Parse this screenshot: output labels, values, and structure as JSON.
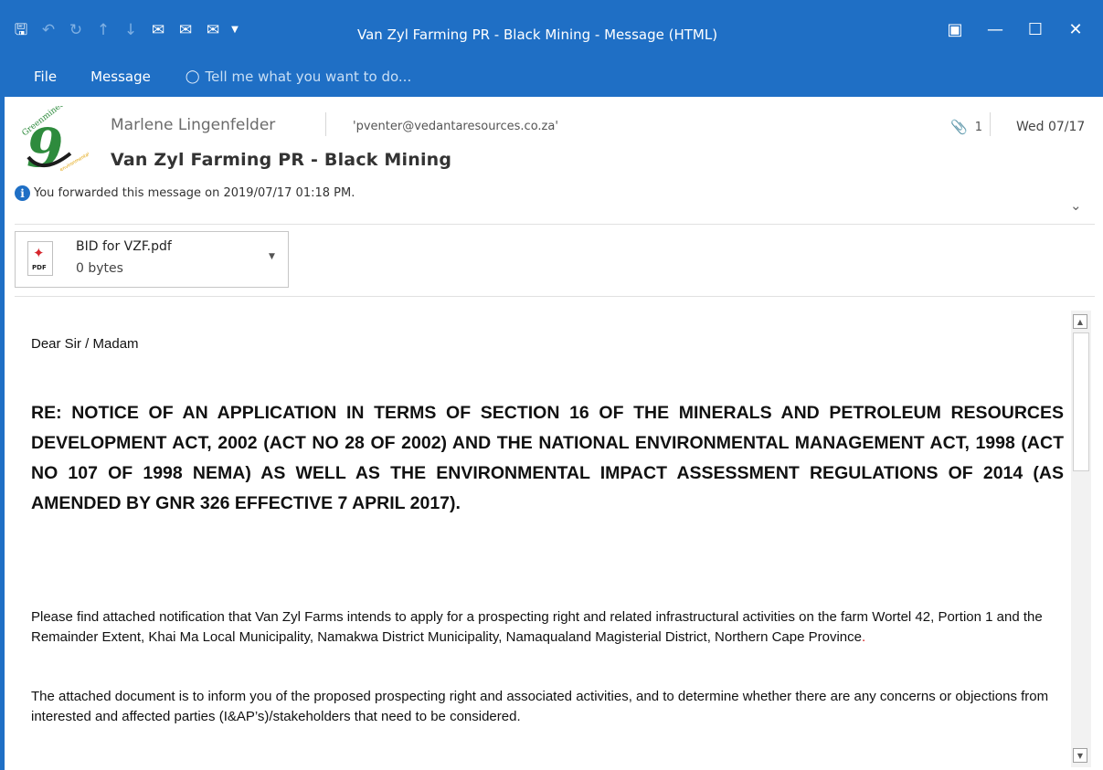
{
  "window": {
    "title": "Van Zyl Farming PR - Black Mining - Message (HTML)"
  },
  "qat": {
    "save_icon": "save-icon",
    "undo_icon": "undo-icon",
    "redo_icon": "redo-icon",
    "up_icon": "arrow-up-icon",
    "down_icon": "arrow-down-icon",
    "reply_icon": "reply-icon",
    "reply_all_icon": "reply-all-icon",
    "forward_icon": "forward-icon"
  },
  "menu": {
    "file": "File",
    "message": "Message",
    "tell_me": "Tell me what you want to do..."
  },
  "header": {
    "sender": "Marlene Lingenfelder",
    "recipient": "'pventer@vedantaresources.co.za'",
    "attachment_count": "1",
    "date": "Wed 07/17",
    "subject": "Van Zyl Farming PR - Black Mining",
    "info": "You forwarded this message on 2019/07/17 01:18 PM.",
    "logo_text": "Greenmined"
  },
  "attachment": {
    "name": "BID for VZF.pdf",
    "size": "0 bytes",
    "type_label": "PDF"
  },
  "body": {
    "greeting": "Dear Sir / Madam",
    "re_heading": "RE: NOTICE OF AN APPLICATION IN TERMS OF SECTION 16 OF THE MINERALS AND PETROLEUM RESOURCES DEVELOPMENT ACT, 2002 (ACT NO 28 OF 2002) AND THE NATIONAL ENVIRONMENTAL MANAGEMENT ACT, 1998 (ACT NO 107 OF 1998 NEMA) AS WELL AS THE ENVIRONMENTAL IMPACT ASSESSMENT REGULATIONS OF 2014 (AS AMENDED BY GNR 326 EFFECTIVE 7 APRIL 2017).",
    "para1": "Please find attached notification that Van Zyl Farms intends to apply for a prospecting right and related infrastructural activities on the farm Wortel 42, Portion 1 and the Remainder Extent, Khai Ma Local Municipality, Namakwa District Municipality, Namaqualand Magisterial District, Northern Cape Province",
    "para1_end": ".",
    "para2": "The attached document is to inform you of the proposed prospecting  right and associated activities, and to determine whether there are any concerns or objections from interested and affected parties (I&AP’s)/stakeholders that need to be considered."
  },
  "colors": {
    "ribbon": "#1f6fc5",
    "logo_green": "#2e8b3d"
  }
}
